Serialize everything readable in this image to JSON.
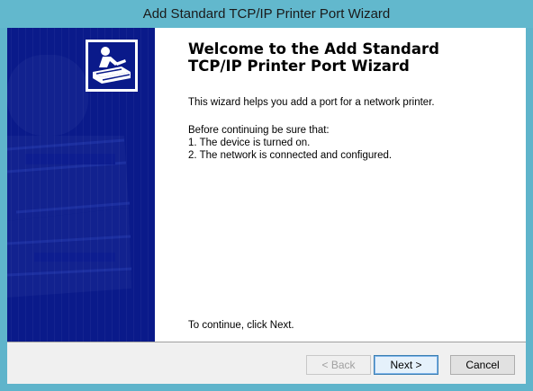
{
  "window": {
    "title": "Add Standard TCP/IP Printer Port Wizard"
  },
  "content": {
    "heading_line1": "Welcome to the Add Standard",
    "heading_line2": "TCP/IP Printer Port Wizard",
    "intro": "This wizard helps you add a port for a network printer.",
    "before": "Before continuing be sure that:",
    "item1": "1.  The device is turned on.",
    "item2": "2.  The network is connected and configured.",
    "continue": "To continue, click Next."
  },
  "buttons": {
    "back": "< Back",
    "next": "Next >",
    "cancel": "Cancel"
  },
  "icons": {
    "wizard": "printer-wizard-icon"
  },
  "colors": {
    "side_panel": "#0a1a8a",
    "title_bar": "#62b8cd"
  }
}
